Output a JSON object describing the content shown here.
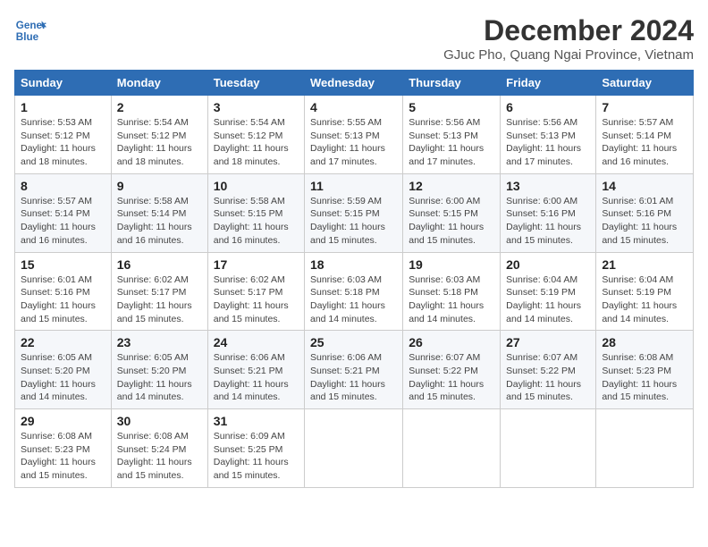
{
  "logo": {
    "line1": "General",
    "line2": "Blue"
  },
  "title": "December 2024",
  "location": "GJuc Pho, Quang Ngai Province, Vietnam",
  "headers": [
    "Sunday",
    "Monday",
    "Tuesday",
    "Wednesday",
    "Thursday",
    "Friday",
    "Saturday"
  ],
  "weeks": [
    [
      {
        "day": "1",
        "info": "Sunrise: 5:53 AM\nSunset: 5:12 PM\nDaylight: 11 hours\nand 18 minutes."
      },
      {
        "day": "2",
        "info": "Sunrise: 5:54 AM\nSunset: 5:12 PM\nDaylight: 11 hours\nand 18 minutes."
      },
      {
        "day": "3",
        "info": "Sunrise: 5:54 AM\nSunset: 5:12 PM\nDaylight: 11 hours\nand 18 minutes."
      },
      {
        "day": "4",
        "info": "Sunrise: 5:55 AM\nSunset: 5:13 PM\nDaylight: 11 hours\nand 17 minutes."
      },
      {
        "day": "5",
        "info": "Sunrise: 5:56 AM\nSunset: 5:13 PM\nDaylight: 11 hours\nand 17 minutes."
      },
      {
        "day": "6",
        "info": "Sunrise: 5:56 AM\nSunset: 5:13 PM\nDaylight: 11 hours\nand 17 minutes."
      },
      {
        "day": "7",
        "info": "Sunrise: 5:57 AM\nSunset: 5:14 PM\nDaylight: 11 hours\nand 16 minutes."
      }
    ],
    [
      {
        "day": "8",
        "info": "Sunrise: 5:57 AM\nSunset: 5:14 PM\nDaylight: 11 hours\nand 16 minutes."
      },
      {
        "day": "9",
        "info": "Sunrise: 5:58 AM\nSunset: 5:14 PM\nDaylight: 11 hours\nand 16 minutes."
      },
      {
        "day": "10",
        "info": "Sunrise: 5:58 AM\nSunset: 5:15 PM\nDaylight: 11 hours\nand 16 minutes."
      },
      {
        "day": "11",
        "info": "Sunrise: 5:59 AM\nSunset: 5:15 PM\nDaylight: 11 hours\nand 15 minutes."
      },
      {
        "day": "12",
        "info": "Sunrise: 6:00 AM\nSunset: 5:15 PM\nDaylight: 11 hours\nand 15 minutes."
      },
      {
        "day": "13",
        "info": "Sunrise: 6:00 AM\nSunset: 5:16 PM\nDaylight: 11 hours\nand 15 minutes."
      },
      {
        "day": "14",
        "info": "Sunrise: 6:01 AM\nSunset: 5:16 PM\nDaylight: 11 hours\nand 15 minutes."
      }
    ],
    [
      {
        "day": "15",
        "info": "Sunrise: 6:01 AM\nSunset: 5:16 PM\nDaylight: 11 hours\nand 15 minutes."
      },
      {
        "day": "16",
        "info": "Sunrise: 6:02 AM\nSunset: 5:17 PM\nDaylight: 11 hours\nand 15 minutes."
      },
      {
        "day": "17",
        "info": "Sunrise: 6:02 AM\nSunset: 5:17 PM\nDaylight: 11 hours\nand 15 minutes."
      },
      {
        "day": "18",
        "info": "Sunrise: 6:03 AM\nSunset: 5:18 PM\nDaylight: 11 hours\nand 14 minutes."
      },
      {
        "day": "19",
        "info": "Sunrise: 6:03 AM\nSunset: 5:18 PM\nDaylight: 11 hours\nand 14 minutes."
      },
      {
        "day": "20",
        "info": "Sunrise: 6:04 AM\nSunset: 5:19 PM\nDaylight: 11 hours\nand 14 minutes."
      },
      {
        "day": "21",
        "info": "Sunrise: 6:04 AM\nSunset: 5:19 PM\nDaylight: 11 hours\nand 14 minutes."
      }
    ],
    [
      {
        "day": "22",
        "info": "Sunrise: 6:05 AM\nSunset: 5:20 PM\nDaylight: 11 hours\nand 14 minutes."
      },
      {
        "day": "23",
        "info": "Sunrise: 6:05 AM\nSunset: 5:20 PM\nDaylight: 11 hours\nand 14 minutes."
      },
      {
        "day": "24",
        "info": "Sunrise: 6:06 AM\nSunset: 5:21 PM\nDaylight: 11 hours\nand 14 minutes."
      },
      {
        "day": "25",
        "info": "Sunrise: 6:06 AM\nSunset: 5:21 PM\nDaylight: 11 hours\nand 15 minutes."
      },
      {
        "day": "26",
        "info": "Sunrise: 6:07 AM\nSunset: 5:22 PM\nDaylight: 11 hours\nand 15 minutes."
      },
      {
        "day": "27",
        "info": "Sunrise: 6:07 AM\nSunset: 5:22 PM\nDaylight: 11 hours\nand 15 minutes."
      },
      {
        "day": "28",
        "info": "Sunrise: 6:08 AM\nSunset: 5:23 PM\nDaylight: 11 hours\nand 15 minutes."
      }
    ],
    [
      {
        "day": "29",
        "info": "Sunrise: 6:08 AM\nSunset: 5:23 PM\nDaylight: 11 hours\nand 15 minutes."
      },
      {
        "day": "30",
        "info": "Sunrise: 6:08 AM\nSunset: 5:24 PM\nDaylight: 11 hours\nand 15 minutes."
      },
      {
        "day": "31",
        "info": "Sunrise: 6:09 AM\nSunset: 5:25 PM\nDaylight: 11 hours\nand 15 minutes."
      },
      {
        "day": "",
        "info": ""
      },
      {
        "day": "",
        "info": ""
      },
      {
        "day": "",
        "info": ""
      },
      {
        "day": "",
        "info": ""
      }
    ]
  ]
}
